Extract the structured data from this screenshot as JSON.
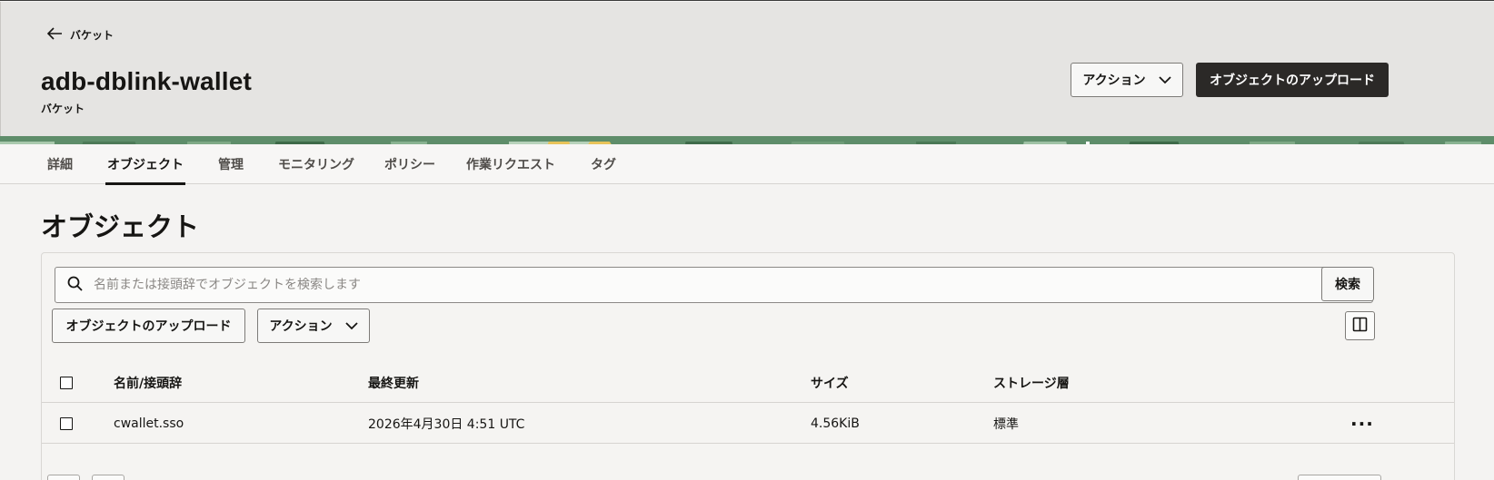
{
  "header": {
    "back_label": "バケット",
    "title": "adb-dblink-wallet",
    "subtitle": "バケット",
    "actions_label": "アクション",
    "upload_label": "オブジェクトのアップロード"
  },
  "tabs": [
    {
      "label": "詳細"
    },
    {
      "label": "オブジェクト"
    },
    {
      "label": "管理"
    },
    {
      "label": "モニタリング"
    },
    {
      "label": "ポリシー"
    },
    {
      "label": "作業リクエスト"
    },
    {
      "label": "タグ"
    }
  ],
  "section": {
    "title": "オブジェクト",
    "search_placeholder": "名前または接頭辞でオブジェクトを検索します",
    "search_button": "検索",
    "upload_label": "オブジェクトのアップロード",
    "actions_label": "アクション"
  },
  "table": {
    "columns": [
      "名前/接頭辞",
      "最終更新",
      "サイズ",
      "ストレージ層"
    ],
    "rows": [
      {
        "name": "cwallet.sso",
        "modified": "2026年4月30日 4:51 UTC",
        "size": "4.56KiB",
        "tier": "標準",
        "more": "···"
      }
    ]
  },
  "colors": {
    "header_bg": "#e5e4e2",
    "primary_button": "#2b2927",
    "banner_green": "#5e8d6a",
    "banner_accent": "#e8c35a"
  }
}
